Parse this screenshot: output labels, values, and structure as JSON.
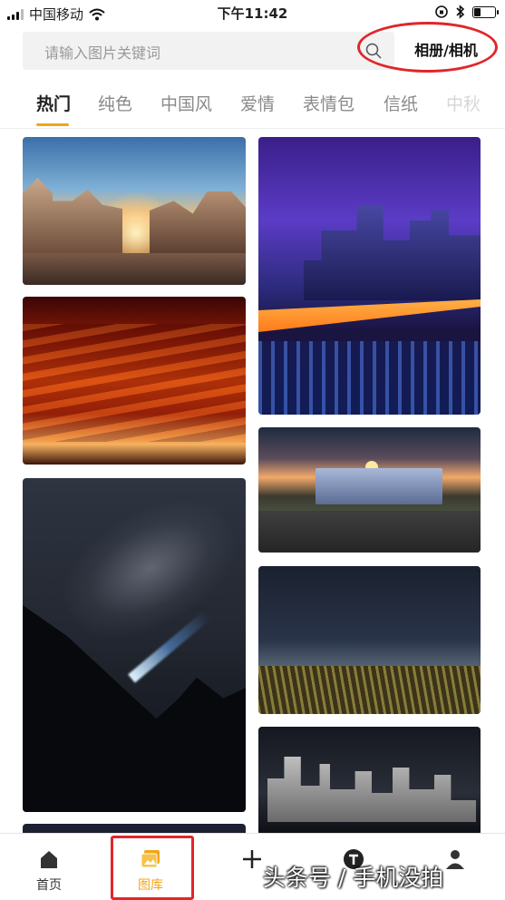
{
  "status_bar": {
    "carrier": "中国移动",
    "time": "下午11:42"
  },
  "search": {
    "placeholder": "请输入图片关键词",
    "album_button": "相册/相机"
  },
  "tabs": [
    {
      "label": "热门",
      "active": true
    },
    {
      "label": "纯色"
    },
    {
      "label": "中国风"
    },
    {
      "label": "爱情"
    },
    {
      "label": "表情包"
    },
    {
      "label": "信纸"
    },
    {
      "label": "中秋"
    }
  ],
  "photos": [
    {
      "name": "old-town-sunset-photo",
      "subject": "old town square at sunset"
    },
    {
      "name": "city-bridge-night-photo",
      "subject": "city skyline and bridge at night"
    },
    {
      "name": "red-clouds-sky-photo",
      "subject": "fiery red cloudy sky"
    },
    {
      "name": "truck-sunset-photo",
      "subject": "truck on road at sunset"
    },
    {
      "name": "milky-way-mountain-photo",
      "subject": "milky way over mountains with flashlight"
    },
    {
      "name": "cornfield-night-photo",
      "subject": "cornfield under night sky"
    },
    {
      "name": "city-skyline-night-photo",
      "subject": "city skyline at night"
    }
  ],
  "bottom_nav": {
    "home": "首页",
    "gallery": "图库",
    "add_icon": "plus-icon",
    "text_icon": "text-t-icon",
    "mine_icon": "person-icon"
  },
  "watermark": "头条号 / 手机没拍",
  "colors": {
    "accent": "#f2a51a",
    "annotation": "#e0262a"
  }
}
